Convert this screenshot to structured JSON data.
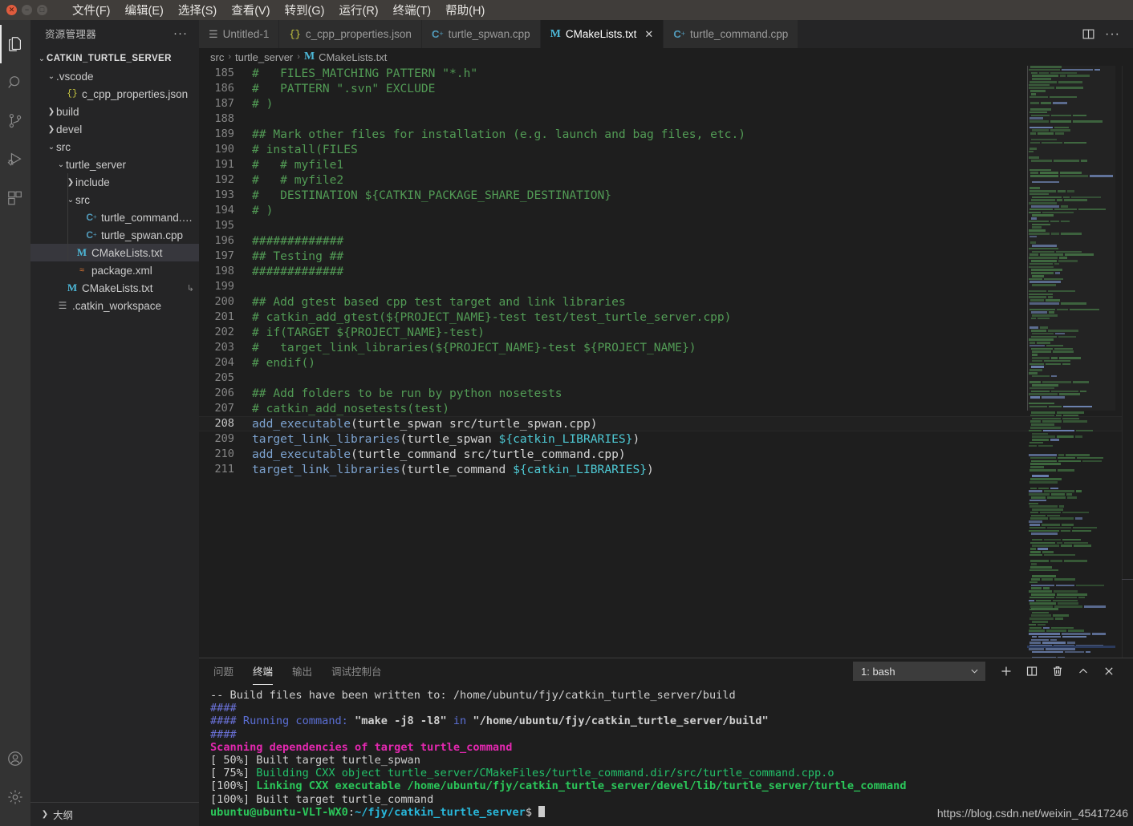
{
  "window": {
    "controls": [
      "close",
      "minimize",
      "maximize"
    ],
    "menu": [
      "文件(F)",
      "编辑(E)",
      "选择(S)",
      "查看(V)",
      "转到(G)",
      "运行(R)",
      "终端(T)",
      "帮助(H)"
    ]
  },
  "activitybar": {
    "items": [
      {
        "name": "explorer",
        "icon": "files-icon",
        "active": true
      },
      {
        "name": "search",
        "icon": "search-icon",
        "active": false
      },
      {
        "name": "source-control",
        "icon": "source-control-icon",
        "active": false
      },
      {
        "name": "run-debug",
        "icon": "run-debug-icon",
        "active": false
      },
      {
        "name": "extensions",
        "icon": "extensions-icon",
        "active": false
      }
    ],
    "bottom": [
      {
        "name": "accounts",
        "icon": "account-icon"
      },
      {
        "name": "manage",
        "icon": "gear-icon"
      }
    ]
  },
  "sidebar": {
    "title": "资源管理器",
    "more_actions": "···",
    "outline_label": "大纲",
    "tree": [
      {
        "label": "CATKIN_TURTLE_SERVER",
        "indent": 0,
        "twist": "v",
        "kind": "root"
      },
      {
        "label": ".vscode",
        "indent": 1,
        "twist": "v",
        "kind": "folder"
      },
      {
        "label": "c_cpp_properties.json",
        "indent": 2,
        "twist": "",
        "kind": "json"
      },
      {
        "label": "build",
        "indent": 1,
        "twist": ">",
        "kind": "folder"
      },
      {
        "label": "devel",
        "indent": 1,
        "twist": ">",
        "kind": "folder"
      },
      {
        "label": "src",
        "indent": 1,
        "twist": "v",
        "kind": "folder"
      },
      {
        "label": "turtle_server",
        "indent": 2,
        "twist": "v",
        "kind": "folder"
      },
      {
        "label": "include",
        "indent": 3,
        "twist": ">",
        "kind": "folder"
      },
      {
        "label": "src",
        "indent": 3,
        "twist": "v",
        "kind": "folder"
      },
      {
        "label": "turtle_command.cpp",
        "indent": 4,
        "twist": "",
        "kind": "cpp"
      },
      {
        "label": "turtle_spwan.cpp",
        "indent": 4,
        "twist": "",
        "kind": "cpp"
      },
      {
        "label": "CMakeLists.txt",
        "indent": 3,
        "twist": "",
        "kind": "cmake",
        "selected": true
      },
      {
        "label": "package.xml",
        "indent": 3,
        "twist": "",
        "kind": "xml"
      },
      {
        "label": "CMakeLists.txt",
        "indent": 2,
        "twist": "",
        "kind": "cmake",
        "trailing": "↳"
      },
      {
        "label": ".catkin_workspace",
        "indent": 1,
        "twist": "",
        "kind": "txt"
      }
    ]
  },
  "editor": {
    "tabs": [
      {
        "label": "Untitled-1",
        "icon": "untitled",
        "active": false,
        "close": false
      },
      {
        "label": "c_cpp_properties.json",
        "icon": "json",
        "active": false,
        "close": false
      },
      {
        "label": "turtle_spwan.cpp",
        "icon": "cpp",
        "active": false,
        "close": false
      },
      {
        "label": "CMakeLists.txt",
        "icon": "cmake",
        "active": true,
        "close": true
      },
      {
        "label": "turtle_command.cpp",
        "icon": "cpp",
        "active": false,
        "close": false
      }
    ],
    "tab_close_glyph": "✕",
    "actions": [
      {
        "name": "split-editor-icon"
      },
      {
        "name": "more-actions-icon",
        "glyph": "···"
      }
    ],
    "breadcrumb": [
      "src",
      "turtle_server",
      "CMakeLists.txt"
    ],
    "breadcrumb_sep": "›",
    "lines": [
      {
        "n": 185,
        "segs": [
          {
            "t": "#   FILES_MATCHING PATTERN \"*.h\"",
            "c": "cm"
          }
        ]
      },
      {
        "n": 186,
        "segs": [
          {
            "t": "#   PATTERN \".svn\" EXCLUDE",
            "c": "cm"
          }
        ]
      },
      {
        "n": 187,
        "segs": [
          {
            "t": "# )",
            "c": "cm"
          }
        ]
      },
      {
        "n": 188,
        "segs": [
          {
            "t": "",
            "c": "cm"
          }
        ]
      },
      {
        "n": 189,
        "segs": [
          {
            "t": "## Mark other files for installation (e.g. launch and bag files, etc.)",
            "c": "cm"
          }
        ]
      },
      {
        "n": 190,
        "segs": [
          {
            "t": "# install(FILES",
            "c": "cm"
          }
        ]
      },
      {
        "n": 191,
        "segs": [
          {
            "t": "#   # myfile1",
            "c": "cm"
          }
        ]
      },
      {
        "n": 192,
        "segs": [
          {
            "t": "#   # myfile2",
            "c": "cm"
          }
        ]
      },
      {
        "n": 193,
        "segs": [
          {
            "t": "#   DESTINATION ${CATKIN_PACKAGE_SHARE_DESTINATION}",
            "c": "cm"
          }
        ]
      },
      {
        "n": 194,
        "segs": [
          {
            "t": "# )",
            "c": "cm"
          }
        ]
      },
      {
        "n": 195,
        "segs": [
          {
            "t": "",
            "c": "cm"
          }
        ]
      },
      {
        "n": 196,
        "segs": [
          {
            "t": "#############",
            "c": "cm"
          }
        ]
      },
      {
        "n": 197,
        "segs": [
          {
            "t": "## Testing ##",
            "c": "cm"
          }
        ]
      },
      {
        "n": 198,
        "segs": [
          {
            "t": "#############",
            "c": "cm"
          }
        ]
      },
      {
        "n": 199,
        "segs": [
          {
            "t": "",
            "c": "cm"
          }
        ]
      },
      {
        "n": 200,
        "segs": [
          {
            "t": "## Add gtest based cpp test target and link libraries",
            "c": "cm"
          }
        ]
      },
      {
        "n": 201,
        "segs": [
          {
            "t": "# catkin_add_gtest(${PROJECT_NAME}-test test/test_turtle_server.cpp)",
            "c": "cm"
          }
        ]
      },
      {
        "n": 202,
        "segs": [
          {
            "t": "# if(TARGET ${PROJECT_NAME}-test)",
            "c": "cm"
          }
        ]
      },
      {
        "n": 203,
        "segs": [
          {
            "t": "#   target_link_libraries(${PROJECT_NAME}-test ${PROJECT_NAME})",
            "c": "cm"
          }
        ]
      },
      {
        "n": 204,
        "segs": [
          {
            "t": "# endif()",
            "c": "cm"
          }
        ]
      },
      {
        "n": 205,
        "segs": [
          {
            "t": "",
            "c": "cm"
          }
        ]
      },
      {
        "n": 206,
        "segs": [
          {
            "t": "## Add folders to be run by python nosetests",
            "c": "cm"
          }
        ]
      },
      {
        "n": 207,
        "segs": [
          {
            "t": "# catkin_add_nosetests(test)",
            "c": "cm"
          }
        ]
      },
      {
        "n": 208,
        "current": true,
        "segs": [
          {
            "t": "add_executable",
            "c": "fn"
          },
          {
            "t": "(turtle_spwan src/turtle_spwan.cpp)",
            "c": "pl"
          }
        ]
      },
      {
        "n": 209,
        "segs": [
          {
            "t": "target_link_libraries",
            "c": "fn"
          },
          {
            "t": "(turtle_spwan ",
            "c": "pl"
          },
          {
            "t": "${catkin_LIBRARIES}",
            "c": "vr"
          },
          {
            "t": ")",
            "c": "pl"
          }
        ]
      },
      {
        "n": 210,
        "segs": [
          {
            "t": "add_executable",
            "c": "fn"
          },
          {
            "t": "(turtle_command src/turtle_command.cpp)",
            "c": "pl"
          }
        ]
      },
      {
        "n": 211,
        "segs": [
          {
            "t": "target_link_libraries",
            "c": "fn"
          },
          {
            "t": "(turtle_command ",
            "c": "pl"
          },
          {
            "t": "${catkin_LIBRARIES}",
            "c": "vr"
          },
          {
            "t": ")",
            "c": "pl"
          }
        ]
      }
    ]
  },
  "panel": {
    "tabs": [
      {
        "label": "问题",
        "active": false
      },
      {
        "label": "终端",
        "active": true
      },
      {
        "label": "输出",
        "active": false
      },
      {
        "label": "调试控制台",
        "active": false
      }
    ],
    "terminal_select": "1: bash",
    "select_chevron": "⌄",
    "actions": [
      {
        "name": "new-terminal-button",
        "glyph": "+"
      },
      {
        "name": "split-terminal-button",
        "glyph": "split"
      },
      {
        "name": "kill-terminal-button",
        "glyph": "trash"
      },
      {
        "name": "maximize-panel-button",
        "glyph": "^"
      },
      {
        "name": "close-panel-button",
        "glyph": "✕"
      }
    ],
    "terminal_lines": [
      [
        {
          "t": "-- Build files have been written to: /home/ubuntu/fjy/catkin_turtle_server/build",
          "c": "t-white"
        }
      ],
      [
        {
          "t": "####",
          "c": "t-blue"
        }
      ],
      [
        {
          "t": "#### ",
          "c": "t-blue"
        },
        {
          "t": "Running command: ",
          "c": "t-blue2"
        },
        {
          "t": "\"make -j8 -l8\"",
          "c": "t-white",
          "b": true
        },
        {
          "t": " in ",
          "c": "t-blue2"
        },
        {
          "t": "\"/home/ubuntu/fjy/catkin_turtle_server/build\"",
          "c": "t-white",
          "b": true
        }
      ],
      [
        {
          "t": "####",
          "c": "t-blue"
        }
      ],
      [
        {
          "t": "Scanning dependencies of target turtle_command",
          "c": "t-mag"
        }
      ],
      [
        {
          "t": "[ 50%] Built target turtle_spwan",
          "c": "t-white"
        }
      ],
      [
        {
          "t": "[ 75%] ",
          "c": "t-white"
        },
        {
          "t": "Building CXX object turtle_server/CMakeFiles/turtle_command.dir/src/turtle_command.cpp.o",
          "c": "t-green2"
        }
      ],
      [
        {
          "t": "[100%] ",
          "c": "t-white"
        },
        {
          "t": "Linking CXX executable /home/ubuntu/fjy/catkin_turtle_server/devel/lib/turtle_server/turtle_command",
          "c": "t-green"
        }
      ],
      [
        {
          "t": "[100%] Built target turtle_command",
          "c": "t-white"
        }
      ],
      [
        {
          "t": "ubuntu@ubuntu-VLT-WX0",
          "c": "t-green"
        },
        {
          "t": ":",
          "c": "t-white"
        },
        {
          "t": "~/fjy/catkin_turtle_server",
          "c": "t-cyan"
        },
        {
          "t": "$ ",
          "c": "t-white"
        },
        {
          "t": "CURSOR",
          "c": "cursor"
        }
      ]
    ]
  },
  "watermark": "https://blog.csdn.net/weixin_45417246",
  "colors": {
    "titlebar_bg": "#403d3a",
    "activitybar_bg": "#333333",
    "sidebar_bg": "#252526",
    "editor_bg": "#1e1e1e",
    "tab_active_bg": "#1e1e1e",
    "tab_inactive_bg": "#2d2d2d",
    "selection_bg": "#37373d",
    "comment_green": "#529b55",
    "function_blue": "#7da3d0",
    "variable_cyan": "#4ec9d4"
  }
}
